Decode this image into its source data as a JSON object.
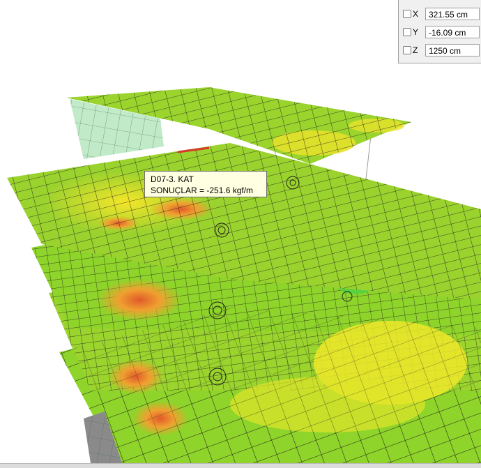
{
  "coordinates": {
    "x": {
      "axis": "X",
      "value": "321.55 cm",
      "checked": false
    },
    "y": {
      "axis": "Y",
      "value": "-16.09 cm",
      "checked": false
    },
    "z": {
      "axis": "Z",
      "value": "1250 cm",
      "checked": false
    }
  },
  "tooltip": {
    "line1": "D07-3. KAT",
    "line2": "SONUÇLAR = -251.6 kgf/m"
  },
  "colors": {
    "slab_green": "#8fd42a",
    "slab_yellow": "#e8e22a",
    "slab_orange": "#f0a030",
    "slab_red": "#e0502a",
    "wall": "#b9e8c2",
    "mesh": "#1a1a1a"
  }
}
